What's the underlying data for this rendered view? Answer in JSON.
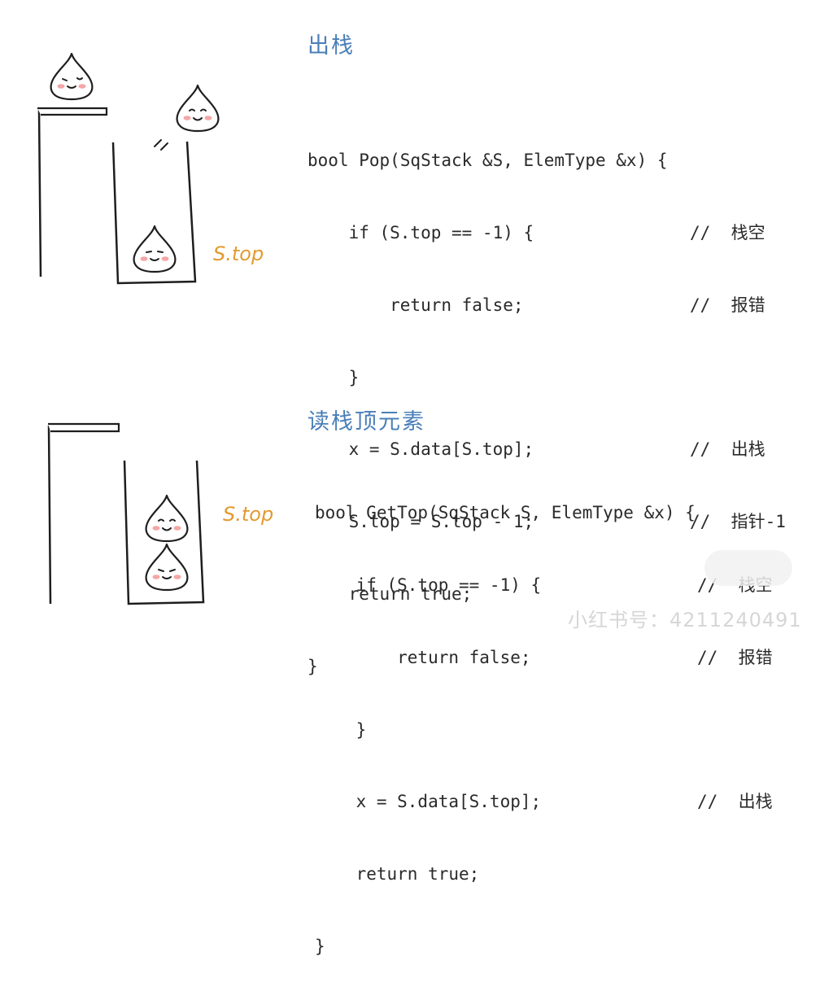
{
  "sections": [
    {
      "title": "出栈",
      "code": [
        {
          "text": "bool Pop(SqStack &S, ElemType &x) {",
          "comment": ""
        },
        {
          "text": "    if (S.top == -1) {",
          "comment": "//  栈空"
        },
        {
          "text": "        return false;",
          "comment": "//  报错"
        },
        {
          "text": "    }",
          "comment": ""
        },
        {
          "text": "    x = S.data[S.top];",
          "comment": "//  出栈"
        },
        {
          "text": "    S.top = S.top - 1;",
          "comment": "//  指针-1"
        },
        {
          "text": "    return true;",
          "comment": ""
        },
        {
          "text": "}",
          "comment": ""
        }
      ],
      "pointer_label": "S.top"
    },
    {
      "title": "读栈顶元素",
      "code": [
        {
          "text": "bool GetTop(SqStack S, ElemType &x) {",
          "comment": ""
        },
        {
          "text": "    if (S.top == -1) {",
          "comment": "//  栈空"
        },
        {
          "text": "        return false;",
          "comment": "//  报错"
        },
        {
          "text": "    }",
          "comment": ""
        },
        {
          "text": "    x = S.data[S.top];",
          "comment": "//  出栈"
        },
        {
          "text": "    return true;",
          "comment": ""
        },
        {
          "text": "}",
          "comment": ""
        }
      ],
      "pointer_label": "S.top"
    }
  ],
  "watermark": "小红书号：4211240491",
  "colors": {
    "title": "#4a7fb8",
    "pointer_label": "#e39a2e",
    "code": "#2a2a2a",
    "blush": "#f4a6a6"
  }
}
